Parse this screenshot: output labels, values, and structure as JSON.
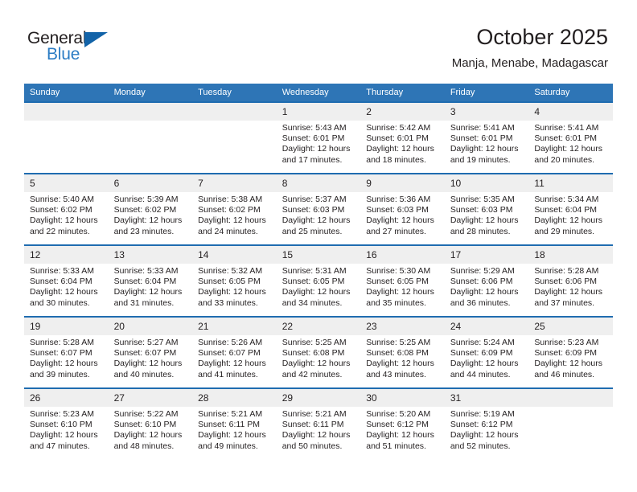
{
  "brand": {
    "name_top": "General",
    "name_bottom": "Blue",
    "accent_color": "#2b7cc4",
    "triangle_color": "#1263a8",
    "triangle_icon": "triangle-icon"
  },
  "header": {
    "title": "October 2025",
    "subtitle": "Manja, Menabe, Madagascar"
  },
  "theme": {
    "header_bg": "#2e75b6",
    "row_border": "#1f6cb0",
    "daynum_bg": "#efefef",
    "text": "#231f20"
  },
  "weekdays": [
    "Sunday",
    "Monday",
    "Tuesday",
    "Wednesday",
    "Thursday",
    "Friday",
    "Saturday"
  ],
  "labels": {
    "sunrise_prefix": "Sunrise:",
    "sunset_prefix": "Sunset:",
    "daylight_prefix": "Daylight:"
  },
  "weeks": [
    [
      {
        "day": "",
        "sunrise": "",
        "sunset": "",
        "daylight": ""
      },
      {
        "day": "",
        "sunrise": "",
        "sunset": "",
        "daylight": ""
      },
      {
        "day": "",
        "sunrise": "",
        "sunset": "",
        "daylight": ""
      },
      {
        "day": "1",
        "sunrise": "Sunrise: 5:43 AM",
        "sunset": "Sunset: 6:01 PM",
        "daylight": "Daylight: 12 hours and 17 minutes."
      },
      {
        "day": "2",
        "sunrise": "Sunrise: 5:42 AM",
        "sunset": "Sunset: 6:01 PM",
        "daylight": "Daylight: 12 hours and 18 minutes."
      },
      {
        "day": "3",
        "sunrise": "Sunrise: 5:41 AM",
        "sunset": "Sunset: 6:01 PM",
        "daylight": "Daylight: 12 hours and 19 minutes."
      },
      {
        "day": "4",
        "sunrise": "Sunrise: 5:41 AM",
        "sunset": "Sunset: 6:01 PM",
        "daylight": "Daylight: 12 hours and 20 minutes."
      }
    ],
    [
      {
        "day": "5",
        "sunrise": "Sunrise: 5:40 AM",
        "sunset": "Sunset: 6:02 PM",
        "daylight": "Daylight: 12 hours and 22 minutes."
      },
      {
        "day": "6",
        "sunrise": "Sunrise: 5:39 AM",
        "sunset": "Sunset: 6:02 PM",
        "daylight": "Daylight: 12 hours and 23 minutes."
      },
      {
        "day": "7",
        "sunrise": "Sunrise: 5:38 AM",
        "sunset": "Sunset: 6:02 PM",
        "daylight": "Daylight: 12 hours and 24 minutes."
      },
      {
        "day": "8",
        "sunrise": "Sunrise: 5:37 AM",
        "sunset": "Sunset: 6:03 PM",
        "daylight": "Daylight: 12 hours and 25 minutes."
      },
      {
        "day": "9",
        "sunrise": "Sunrise: 5:36 AM",
        "sunset": "Sunset: 6:03 PM",
        "daylight": "Daylight: 12 hours and 27 minutes."
      },
      {
        "day": "10",
        "sunrise": "Sunrise: 5:35 AM",
        "sunset": "Sunset: 6:03 PM",
        "daylight": "Daylight: 12 hours and 28 minutes."
      },
      {
        "day": "11",
        "sunrise": "Sunrise: 5:34 AM",
        "sunset": "Sunset: 6:04 PM",
        "daylight": "Daylight: 12 hours and 29 minutes."
      }
    ],
    [
      {
        "day": "12",
        "sunrise": "Sunrise: 5:33 AM",
        "sunset": "Sunset: 6:04 PM",
        "daylight": "Daylight: 12 hours and 30 minutes."
      },
      {
        "day": "13",
        "sunrise": "Sunrise: 5:33 AM",
        "sunset": "Sunset: 6:04 PM",
        "daylight": "Daylight: 12 hours and 31 minutes."
      },
      {
        "day": "14",
        "sunrise": "Sunrise: 5:32 AM",
        "sunset": "Sunset: 6:05 PM",
        "daylight": "Daylight: 12 hours and 33 minutes."
      },
      {
        "day": "15",
        "sunrise": "Sunrise: 5:31 AM",
        "sunset": "Sunset: 6:05 PM",
        "daylight": "Daylight: 12 hours and 34 minutes."
      },
      {
        "day": "16",
        "sunrise": "Sunrise: 5:30 AM",
        "sunset": "Sunset: 6:05 PM",
        "daylight": "Daylight: 12 hours and 35 minutes."
      },
      {
        "day": "17",
        "sunrise": "Sunrise: 5:29 AM",
        "sunset": "Sunset: 6:06 PM",
        "daylight": "Daylight: 12 hours and 36 minutes."
      },
      {
        "day": "18",
        "sunrise": "Sunrise: 5:28 AM",
        "sunset": "Sunset: 6:06 PM",
        "daylight": "Daylight: 12 hours and 37 minutes."
      }
    ],
    [
      {
        "day": "19",
        "sunrise": "Sunrise: 5:28 AM",
        "sunset": "Sunset: 6:07 PM",
        "daylight": "Daylight: 12 hours and 39 minutes."
      },
      {
        "day": "20",
        "sunrise": "Sunrise: 5:27 AM",
        "sunset": "Sunset: 6:07 PM",
        "daylight": "Daylight: 12 hours and 40 minutes."
      },
      {
        "day": "21",
        "sunrise": "Sunrise: 5:26 AM",
        "sunset": "Sunset: 6:07 PM",
        "daylight": "Daylight: 12 hours and 41 minutes."
      },
      {
        "day": "22",
        "sunrise": "Sunrise: 5:25 AM",
        "sunset": "Sunset: 6:08 PM",
        "daylight": "Daylight: 12 hours and 42 minutes."
      },
      {
        "day": "23",
        "sunrise": "Sunrise: 5:25 AM",
        "sunset": "Sunset: 6:08 PM",
        "daylight": "Daylight: 12 hours and 43 minutes."
      },
      {
        "day": "24",
        "sunrise": "Sunrise: 5:24 AM",
        "sunset": "Sunset: 6:09 PM",
        "daylight": "Daylight: 12 hours and 44 minutes."
      },
      {
        "day": "25",
        "sunrise": "Sunrise: 5:23 AM",
        "sunset": "Sunset: 6:09 PM",
        "daylight": "Daylight: 12 hours and 46 minutes."
      }
    ],
    [
      {
        "day": "26",
        "sunrise": "Sunrise: 5:23 AM",
        "sunset": "Sunset: 6:10 PM",
        "daylight": "Daylight: 12 hours and 47 minutes."
      },
      {
        "day": "27",
        "sunrise": "Sunrise: 5:22 AM",
        "sunset": "Sunset: 6:10 PM",
        "daylight": "Daylight: 12 hours and 48 minutes."
      },
      {
        "day": "28",
        "sunrise": "Sunrise: 5:21 AM",
        "sunset": "Sunset: 6:11 PM",
        "daylight": "Daylight: 12 hours and 49 minutes."
      },
      {
        "day": "29",
        "sunrise": "Sunrise: 5:21 AM",
        "sunset": "Sunset: 6:11 PM",
        "daylight": "Daylight: 12 hours and 50 minutes."
      },
      {
        "day": "30",
        "sunrise": "Sunrise: 5:20 AM",
        "sunset": "Sunset: 6:12 PM",
        "daylight": "Daylight: 12 hours and 51 minutes."
      },
      {
        "day": "31",
        "sunrise": "Sunrise: 5:19 AM",
        "sunset": "Sunset: 6:12 PM",
        "daylight": "Daylight: 12 hours and 52 minutes."
      },
      {
        "day": "",
        "sunrise": "",
        "sunset": "",
        "daylight": ""
      }
    ]
  ]
}
